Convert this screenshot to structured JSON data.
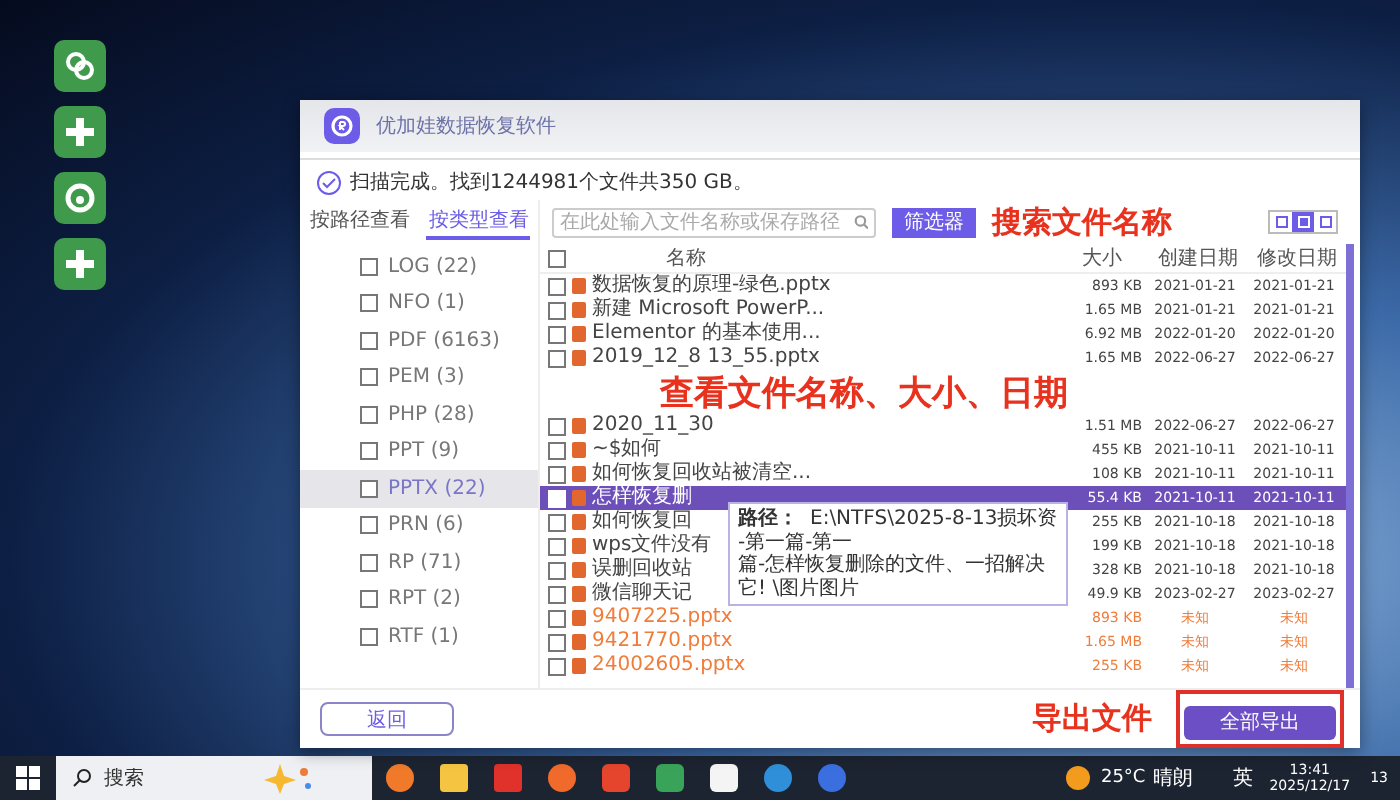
{
  "window": {
    "title": "优加娃数据恢复软件"
  },
  "status": "扫描完成。找到1244981个文件共350 GB。",
  "view_tabs": [
    {
      "label": "按路径查看",
      "selected": false
    },
    {
      "label": "按类型查看",
      "selected": true
    }
  ],
  "file_types": [
    {
      "label": "LOG (22)",
      "checked": false,
      "selected": false
    },
    {
      "label": "NFO (1)",
      "checked": false,
      "selected": false
    },
    {
      "label": "PDF (6163)",
      "checked": false,
      "selected": false
    },
    {
      "label": "PEM (3)",
      "checked": false,
      "selected": false
    },
    {
      "label": "PHP (28)",
      "checked": false,
      "selected": false
    },
    {
      "label": "PPT (9)",
      "checked": false,
      "selected": false
    },
    {
      "label": "PPTX (22)",
      "checked": false,
      "selected": true
    },
    {
      "label": "PRN (6)",
      "checked": false,
      "selected": false
    },
    {
      "label": "RP (71)",
      "checked": false,
      "selected": false
    },
    {
      "label": "RPT (2)",
      "checked": false,
      "selected": false
    },
    {
      "label": "RTF (1)",
      "checked": false,
      "selected": false
    }
  ],
  "search": {
    "placeholder": "在此处输入文件名称或保存路径"
  },
  "filter_button": "筛选器",
  "search_annotation": "搜索文件名称",
  "view_modes": [
    {
      "selected": false
    },
    {
      "selected": true
    },
    {
      "selected": false
    }
  ],
  "table": {
    "select_all": {
      "checked": false
    },
    "columns": [
      "名称",
      "大小",
      "创建日期",
      "修改日期"
    ],
    "rows": [
      {
        "name": "数据恢复的原理-绿色.pptx",
        "size": "893 KB",
        "created": "2021-01-21",
        "modified": "2021-01-21",
        "checked": false,
        "selected": false,
        "color": "#444444"
      },
      {
        "name": "新建 Microsoft PowerP...",
        "size": "1.65 MB",
        "created": "2021-01-21",
        "modified": "2021-01-21",
        "checked": false,
        "selected": false,
        "color": "#444444"
      },
      {
        "name": "Elementor 的基本使用...",
        "size": "6.92 MB",
        "created": "2022-01-20",
        "modified": "2022-01-20",
        "checked": false,
        "selected": false,
        "color": "#444444"
      },
      {
        "name": "2019_12_8 13_55.pptx",
        "size": "1.65 MB",
        "created": "2022-06-27",
        "modified": "2022-06-27",
        "checked": false,
        "selected": false,
        "color": "#444444"
      },
      {
        "name": "2020_11_30",
        "size": "1.51 MB",
        "created": "2022-06-27",
        "modified": "2022-06-27",
        "checked": false,
        "selected": false,
        "color": "#444444"
      },
      {
        "name": "~$如何",
        "size": "455 KB",
        "created": "2021-10-11",
        "modified": "2021-10-11",
        "checked": false,
        "selected": false,
        "color": "#444444"
      },
      {
        "name": "如何恢复回收站被清空...",
        "size": "108 KB",
        "created": "2021-10-11",
        "modified": "2021-10-11",
        "checked": false,
        "selected": false,
        "color": "#444444"
      },
      {
        "name": "怎样恢复删",
        "size": "55.4 KB",
        "created": "2021-10-11",
        "modified": "2021-10-11",
        "checked": false,
        "selected": true
      },
      {
        "name": "如何恢复回",
        "size": "255 KB",
        "created": "2021-10-18",
        "modified": "2021-10-18",
        "checked": false,
        "selected": false,
        "color": "#444444"
      },
      {
        "name": "wps文件没有",
        "size": "199 KB",
        "created": "2021-10-18",
        "modified": "2021-10-18",
        "checked": false,
        "selected": false,
        "color": "#444444"
      },
      {
        "name": "误删回收站",
        "size": "328 KB",
        "created": "2021-10-18",
        "modified": "2021-10-18",
        "checked": false,
        "selected": false,
        "color": "#444444"
      },
      {
        "name": "微信聊天记",
        "size": "49.9 KB",
        "created": "2023-02-27",
        "modified": "2023-02-27",
        "checked": false,
        "selected": false,
        "color": "#444444"
      },
      {
        "name": "9407225.pptx",
        "size": "893 KB",
        "created": "未知",
        "modified": "未知",
        "checked": false,
        "selected": false,
        "color": "#f07c3a"
      },
      {
        "name": "9421770.pptx",
        "size": "1.65 MB",
        "created": "未知",
        "modified": "未知",
        "checked": false,
        "selected": false,
        "color": "#f07c3a"
      },
      {
        "name": "24002605.pptx",
        "size": "255 KB",
        "created": "未知",
        "modified": "未知",
        "checked": false,
        "selected": false,
        "color": "#f07c3a"
      }
    ]
  },
  "tooltip": {
    "label": "路径：",
    "lines": [
      "E:\\NTFS\\2025-8-13损坏资",
      "-第一篇-第一",
      "篇-怎样恢复删除的文件、一招解决",
      "它! \\图片图片"
    ]
  },
  "view_annotation": "查看文件名称、大小、日期",
  "back_button": "返回",
  "export_annotation": "导出文件",
  "export_button": "全部导出",
  "taskbar": {
    "search": {
      "placeholder": "搜索"
    },
    "weather": {
      "temp": "25°C",
      "condition": "晴朗"
    },
    "ime": "英",
    "time": "13:41",
    "date": "2025/12/17",
    "notifications": "13"
  }
}
